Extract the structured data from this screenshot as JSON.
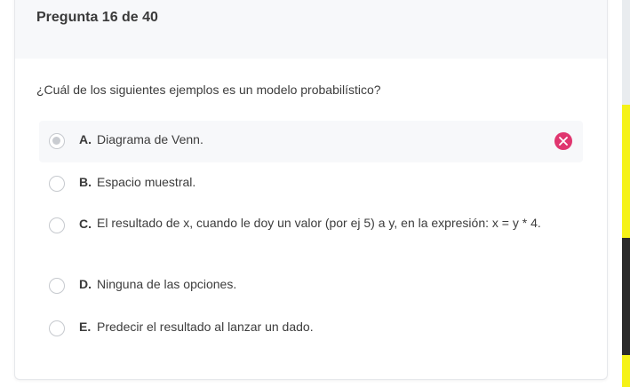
{
  "quiz": {
    "counter": "Pregunta 16 de 40",
    "question": "¿Cuál de los siguientes ejemplos es un modelo probabilístico?",
    "options": [
      {
        "letter": "A.",
        "text": "Diagrama de Venn.",
        "selected": true,
        "status": "incorrect"
      },
      {
        "letter": "B.",
        "text": "Espacio muestral.",
        "selected": false
      },
      {
        "letter": "C.",
        "text": "El resultado de x, cuando le doy un valor (por ej 5) a y, en la expresión: x = y * 4.",
        "selected": false
      },
      {
        "letter": "D.",
        "text": "Ninguna de las opciones.",
        "selected": false
      },
      {
        "letter": "E.",
        "text": "Predecir el resultado al lanzar un dado.",
        "selected": false
      }
    ]
  },
  "colors": {
    "incorrect": "#e0366f",
    "header_bg": "#f7f8fa",
    "side_strip": "#f5f218"
  },
  "icons": {
    "incorrect": "close-icon"
  }
}
